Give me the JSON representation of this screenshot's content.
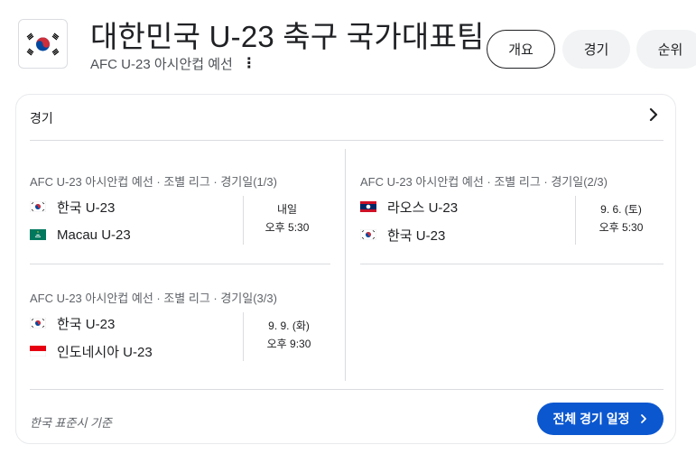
{
  "header": {
    "title": "대한민국 U-23 축구 국가대표팀",
    "subtitle": "AFC U-23 아시안컵 예선",
    "more_icon": "⋮"
  },
  "chips": [
    {
      "label": "개요",
      "selected": true
    },
    {
      "label": "경기",
      "selected": false
    },
    {
      "label": "순위",
      "selected": false
    }
  ],
  "card": {
    "heading": "경기",
    "matches": [
      {
        "title": "AFC U-23 아시안컵 예선 · 조별 리그 · 경기일(1/3)",
        "home": {
          "name": "한국 U-23",
          "flag": "korea-flag-icon"
        },
        "away": {
          "name": "Macau U-23",
          "flag": "macau-flag-icon"
        },
        "date": "내일",
        "time": "오후 5:30"
      },
      {
        "title": "AFC U-23 아시안컵 예선 · 조별 리그 · 경기일(2/3)",
        "home": {
          "name": "라오스 U-23",
          "flag": "laos-flag-icon"
        },
        "away": {
          "name": "한국 U-23",
          "flag": "korea-flag-icon"
        },
        "date": "9. 6. (토)",
        "time": "오후 5:30"
      },
      {
        "title": "AFC U-23 아시안컵 예선 · 조별 리그 · 경기일(3/3)",
        "home": {
          "name": "한국 U-23",
          "flag": "korea-flag-icon"
        },
        "away": {
          "name": "인도네시아 U-23",
          "flag": "indonesia-flag-icon"
        },
        "date": "9. 9. (화)",
        "time": "오후 9:30"
      }
    ],
    "timezone_note": "한국 표준시 기준",
    "schedule_button": "전체 경기 일정"
  },
  "colors": {
    "accent": "#0b57d0",
    "chip_bg": "#f1f3f4",
    "divider": "#dadce0",
    "korea_red": "#cd2e3a",
    "korea_blue": "#0047a0",
    "macau_green": "#00785e",
    "laos_red": "#ce1126",
    "laos_blue": "#002868",
    "indonesia_red": "#e70011"
  }
}
